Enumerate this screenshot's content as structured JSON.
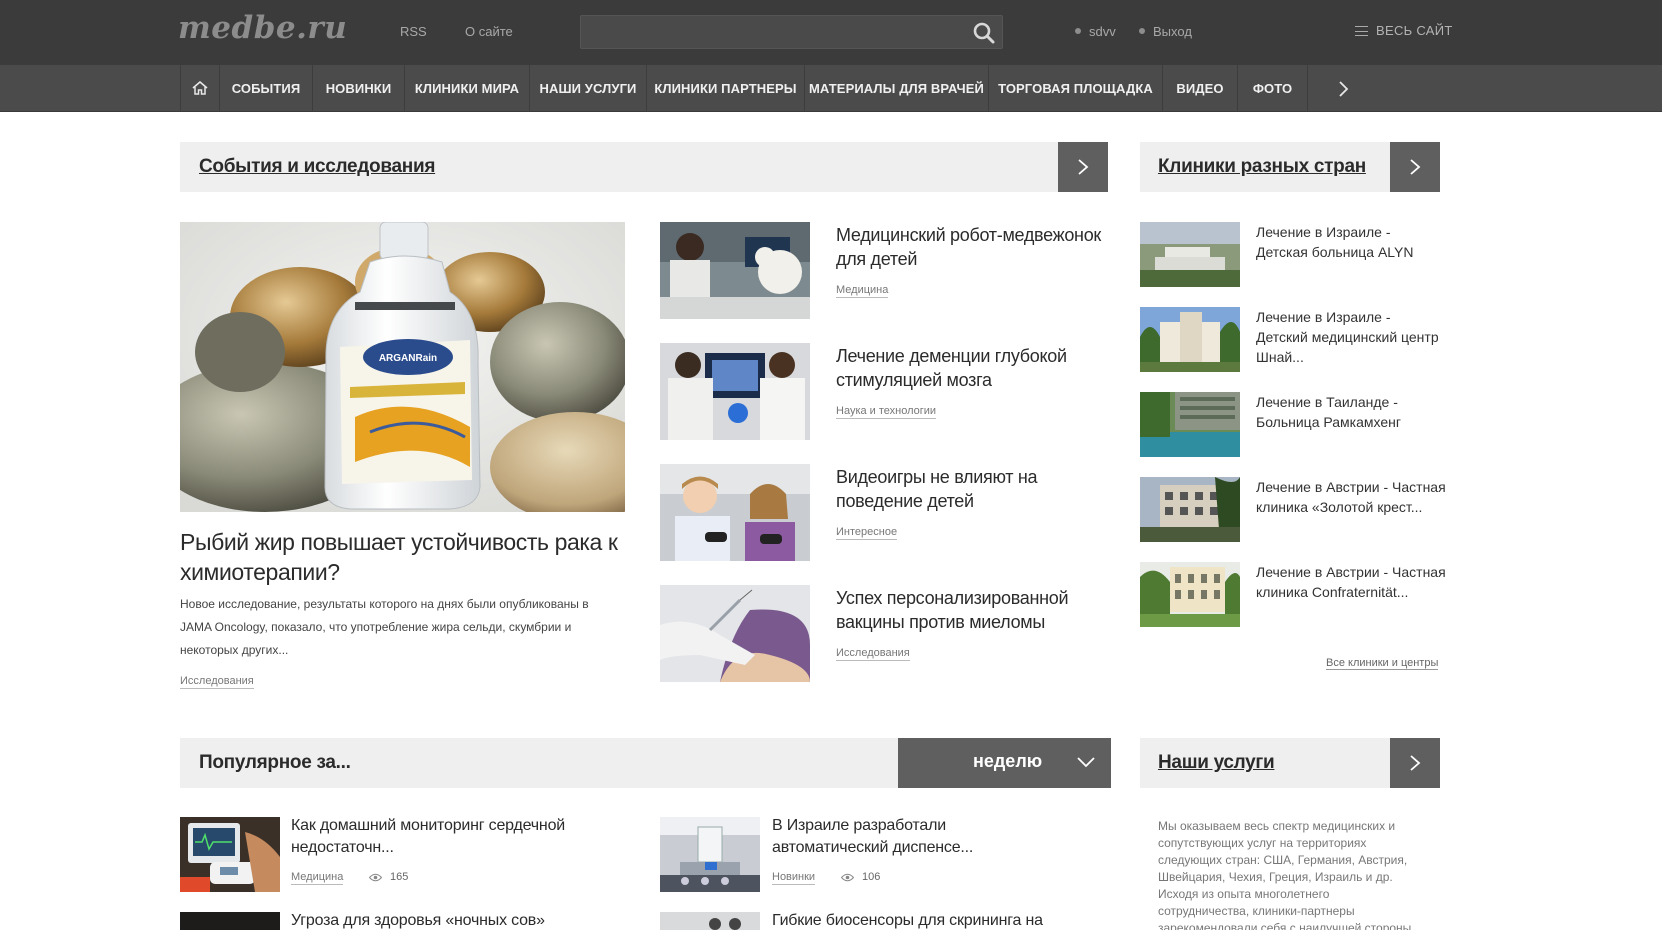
{
  "header": {
    "logo": "medbe.ru",
    "links": [
      "RSS",
      "О сайте"
    ],
    "search": {
      "value": "",
      "placeholder": ""
    },
    "user": "sdvv",
    "logout": "Выход",
    "all_site": "ВЕСЬ САЙТ"
  },
  "nav": {
    "items": [
      "СОБЫТИЯ",
      "НОВИНКИ",
      "КЛИНИКИ МИРА",
      "НАШИ УСЛУГИ",
      "КЛИНИКИ ПАРТНЕРЫ",
      "МАТЕРИАЛЫ ДЛЯ ВРАЧЕЙ",
      "ТОРГОВАЯ ПЛОЩАДКА",
      "ВИДЕО",
      "ФОТО"
    ]
  },
  "events": {
    "title": "События и исследования",
    "feature": {
      "title": "Рыбий жир повышает устойчивость рака к химиотерапии?",
      "text": "Новое исследование, результаты которого на днях были опубликованы в JAMA Oncology, показало, что употребление жира сельди, скумбрии и некоторых других...",
      "tag": "Исследования",
      "bottle_label": "ARGANRain"
    },
    "items": [
      {
        "title": "Медицинский робот-медвежонок для детей",
        "tag": "Медицина"
      },
      {
        "title": "Лечение деменции глубокой стимуляцией мозга",
        "tag": "Наука и технологии"
      },
      {
        "title": "Видеоигры не влияют на поведение детей",
        "tag": "Интересное"
      },
      {
        "title": "Успех персонализированной вакцины против миеломы",
        "tag": "Исследования"
      }
    ]
  },
  "clinics": {
    "title": "Клиники разных стран",
    "items": [
      "Лечение в Израиле - Детская больница ALYN",
      "Лечение в Израиле - Детский медицинский центр Шнай...",
      "Лечение в Таиланде - Больница Рамкамхенг",
      "Лечение в Австрии - Частная клиника «Золотой крест...",
      "Лечение в Австрии - Частная клиника Confraternität..."
    ],
    "all_link": "Все клиники и центры"
  },
  "popular": {
    "title": "Популярное за...",
    "period": "неделю",
    "items": [
      {
        "title": "Как домашний мониторинг сердечной недостаточн...",
        "tag": "Медицина",
        "views": "165"
      },
      {
        "title": "В Израиле разработали автоматический диспенсе...",
        "tag": "Новинки",
        "views": "106"
      },
      {
        "title": "Угроза для здоровья «ночных сов»"
      },
      {
        "title": "Гибкие биосенсоры для скрининга на"
      }
    ]
  },
  "services": {
    "title": "Наши услуги",
    "text": "Мы оказываем весь спектр медицинских и сопутствующих услуг на территориях следующих стран: США, Германия, Австрия, Швейцария, Чехия, Греция, Израиль и др. Исходя из опыта многолетнего сотрудничества, клиники-партнеры зарекомендовали себя с наилучшей стороны"
  }
}
